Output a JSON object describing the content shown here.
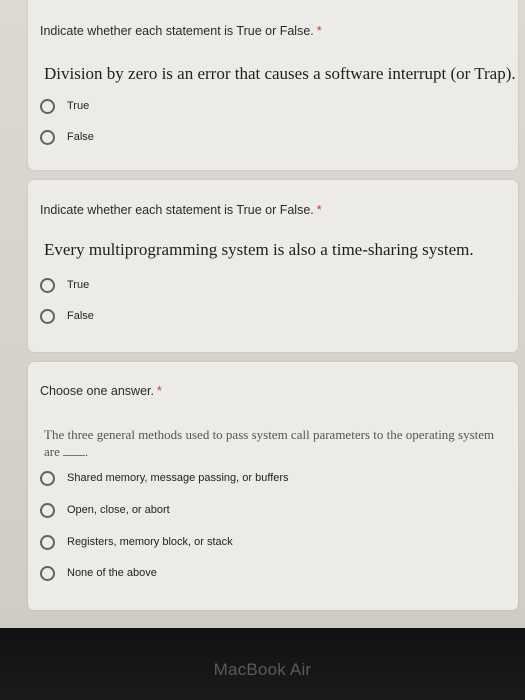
{
  "questions": [
    {
      "prompt": "Indicate whether each statement is True or False.",
      "required_mark": "*",
      "statement": "Division by zero is an error that causes a software interrupt (or Trap).",
      "options": [
        "True",
        "False"
      ]
    },
    {
      "prompt": "Indicate whether each statement is True or False.",
      "required_mark": "*",
      "statement": "Every multiprogramming system is also a time-sharing system.",
      "options": [
        "True",
        "False"
      ]
    },
    {
      "prompt": "Choose one answer.",
      "required_mark": "*",
      "statement": "The three general methods used to pass system call parameters to the operating system are",
      "options": [
        "Shared memory, message passing, or buffers",
        "Open, close, or abort",
        "Registers, memory block, or stack",
        "None of the above"
      ]
    }
  ],
  "device": {
    "bezel_label": "MacBook Air"
  },
  "colors": {
    "required": "#d93025",
    "card": "#ecebe7",
    "radio_border": "#5f6368"
  }
}
